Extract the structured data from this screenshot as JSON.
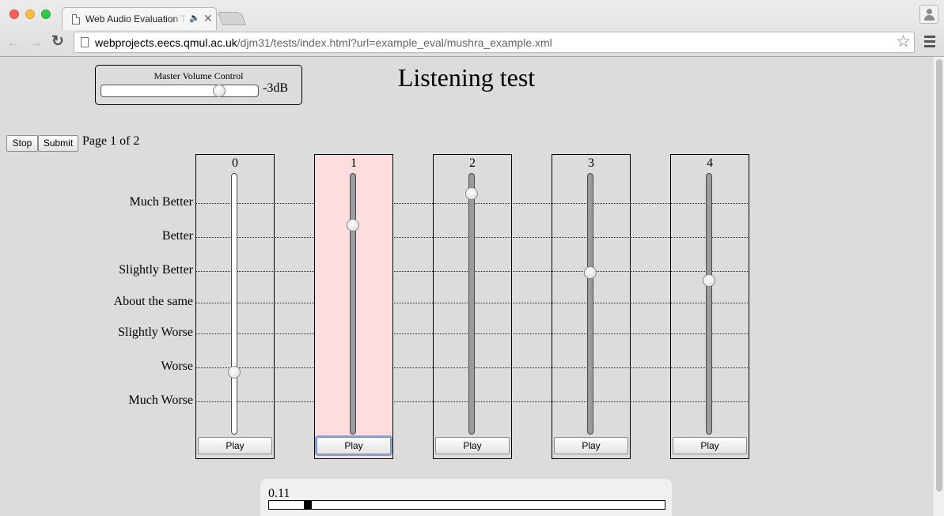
{
  "browser": {
    "tab_title": "Web Audio Evaluation Tool",
    "url_host": "webprojects.eecs.qmul.ac.uk",
    "url_path": "/djm31/tests/index.html?url=example_eval/mushra_example.xml",
    "icons": [
      "back-arrow-icon",
      "forward-arrow-icon",
      "reload-icon",
      "star-icon",
      "menu-icon",
      "profile-icon",
      "speaker-icon",
      "close-icon"
    ]
  },
  "volume": {
    "label": "Master Volume Control",
    "value_text": "-3dB",
    "level_fraction": 0.75
  },
  "title": "Listening test",
  "controls": {
    "stop": "Stop",
    "submit": "Submit",
    "page_counter": "Page 1 of 2"
  },
  "scale": [
    "Much Better",
    "Better",
    "Slightly Better",
    "About the same",
    "Slightly Worse",
    "Worse",
    "Much Worse"
  ],
  "sliders": [
    {
      "label": "0",
      "value": 0.24,
      "play": "Play",
      "selected": false,
      "moved": false
    },
    {
      "label": "1",
      "value": 0.8,
      "play": "Play",
      "selected": true,
      "moved": true
    },
    {
      "label": "2",
      "value": 0.92,
      "play": "Play",
      "selected": false,
      "moved": true
    },
    {
      "label": "3",
      "value": 0.62,
      "play": "Play",
      "selected": false,
      "moved": true
    },
    {
      "label": "4",
      "value": 0.59,
      "play": "Play",
      "selected": false,
      "moved": true
    }
  ],
  "playback": {
    "time": "0.11",
    "progress_fraction": 0.1
  },
  "colors": {
    "selected_box": "#fddddd",
    "focus_ring": "#7aa7e8"
  }
}
